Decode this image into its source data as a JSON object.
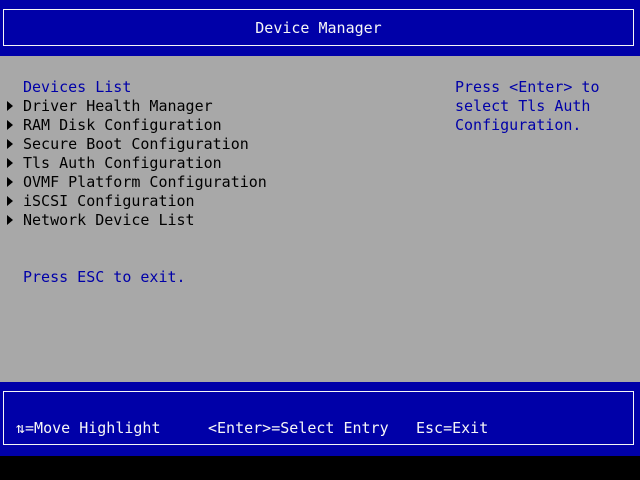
{
  "header": {
    "title": "Device Manager"
  },
  "section_title": "Devices List",
  "menu_items": [
    {
      "label": "Driver Health Manager"
    },
    {
      "label": "RAM Disk Configuration"
    },
    {
      "label": "Secure Boot Configuration"
    },
    {
      "label": "Tls Auth Configuration"
    },
    {
      "label": "OVMF Platform Configuration"
    },
    {
      "label": "iSCSI Configuration"
    },
    {
      "label": "Network Device List"
    }
  ],
  "exit_hint": "Press ESC to exit.",
  "help_panel": {
    "lines": [
      "Press <Enter> to",
      "select Tls Auth",
      "Configuration."
    ]
  },
  "footer": {
    "move_highlight": "⇅=Move Highlight",
    "select_entry": "<Enter>=Select Entry",
    "exit": "Esc=Exit"
  },
  "colors": {
    "blue": "#0000a8",
    "gray": "#a8a8a8",
    "white": "#f6f6f6",
    "black": "#000000"
  }
}
